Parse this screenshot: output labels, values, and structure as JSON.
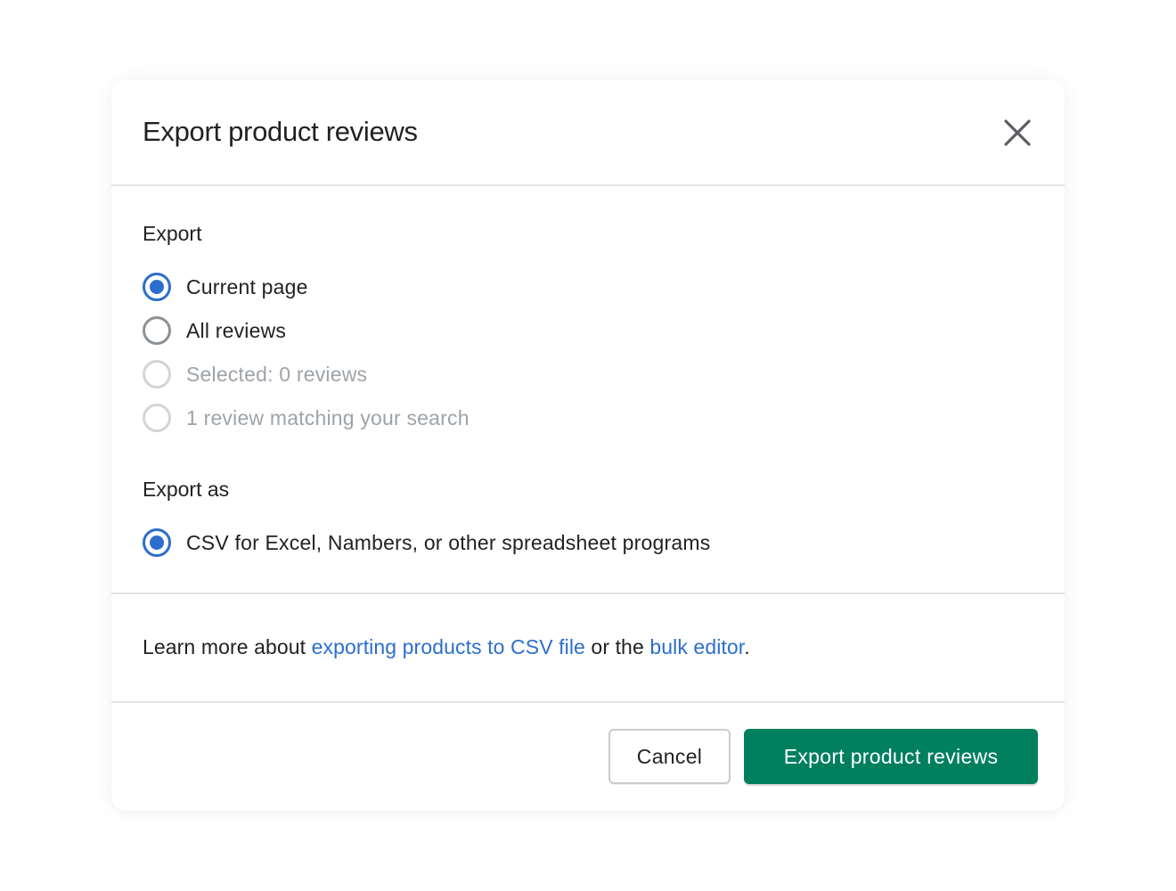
{
  "modal": {
    "title": "Export product reviews",
    "close_icon": "close-icon"
  },
  "export": {
    "label": "Export",
    "options": [
      {
        "label": "Current page",
        "checked": true,
        "disabled": false
      },
      {
        "label": "All reviews",
        "checked": false,
        "disabled": false
      },
      {
        "label": "Selected: 0 reviews",
        "checked": false,
        "disabled": true
      },
      {
        "label": "1 review matching your search",
        "checked": false,
        "disabled": true
      }
    ]
  },
  "export_as": {
    "label": "Export as",
    "options": [
      {
        "label": "CSV for Excel, Nambers, or other spreadsheet programs",
        "checked": true,
        "disabled": false
      }
    ]
  },
  "learn_more": {
    "prefix": "Learn more about ",
    "link1": "exporting products to CSV file",
    "middle": " or the ",
    "link2": "bulk editor",
    "suffix": "."
  },
  "footer": {
    "cancel_label": "Cancel",
    "primary_label": "Export product reviews"
  },
  "colors": {
    "primary": "#007f5f",
    "accent": "#2c6ecb",
    "text": "#202223",
    "disabled_text": "#9ea3a8"
  }
}
